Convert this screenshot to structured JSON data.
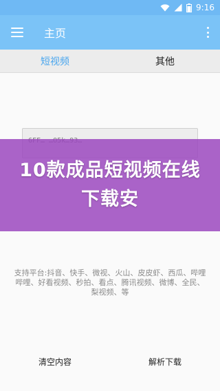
{
  "status_bar": {
    "time": "9:16",
    "icons": [
      "wifi-icon",
      "signal-icon",
      "battery-icon"
    ]
  },
  "app_bar": {
    "title": "主页",
    "menu_icon": "menu-icon",
    "more_icon": "more-vert-icon"
  },
  "tabs": [
    {
      "label": "短视频",
      "active": true
    },
    {
      "label": "其他",
      "active": false
    }
  ],
  "url_input": {
    "value": "6FF…      …O5k…93…"
  },
  "banner": {
    "text": "10款成品短视频在线下载安"
  },
  "platforms_text": "支持平台:抖音、快手、微视、火山、皮皮虾、西瓜、哔哩哔哩、好看视频、秒拍、看点、腾讯视频、微博、全民、梨视频、等",
  "actions": {
    "clear": "清空内容",
    "parse": "解析下载"
  },
  "colors": {
    "app_bar": "#7bc3f7",
    "status_bar": "#6fb9f4",
    "tab_active": "#4aa6ee",
    "banner_overlay": "#9b48be"
  }
}
